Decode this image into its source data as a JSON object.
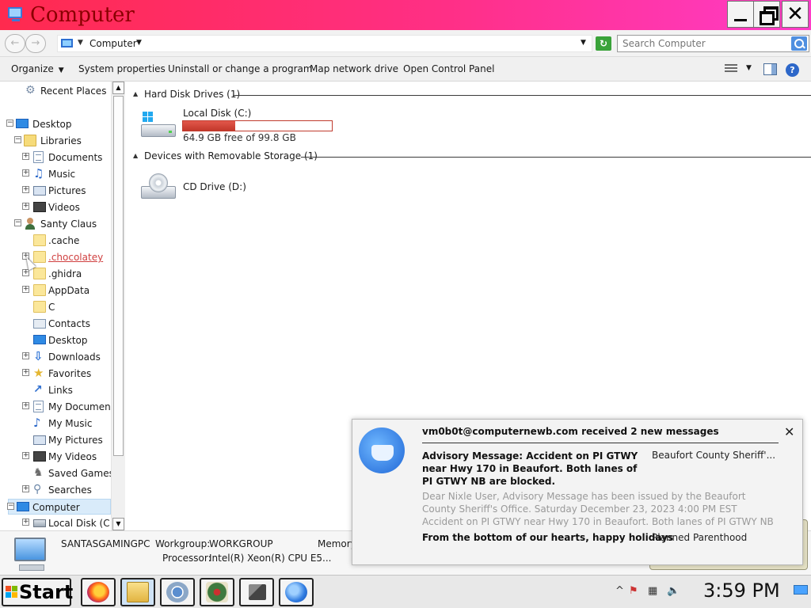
{
  "window": {
    "title": "Computer",
    "minimize_label": "",
    "maximize_label": "",
    "close_label": "✕"
  },
  "address": {
    "crumb": "Computer",
    "search_placeholder": "Search Computer"
  },
  "toolbar": {
    "organize": "Organize",
    "system_properties": "System properties",
    "uninstall": "Uninstall or change a program",
    "map_drive": "Map network drive",
    "control_panel": "Open Control Panel"
  },
  "nav": {
    "recent_places": "Recent Places",
    "desktop": "Desktop",
    "libraries": "Libraries",
    "documents": "Documents",
    "music": "Music",
    "pictures": "Pictures",
    "videos": "Videos",
    "user": "Santy Claus",
    "cache": ".cache",
    "chocolatey": ".chocolatey",
    "ghidra": ".ghidra",
    "appdata": "AppData",
    "c": "C",
    "contacts": "Contacts",
    "desktop2": "Desktop",
    "downloads": "Downloads",
    "favorites": "Favorites",
    "links": "Links",
    "my_documents": "My Documents",
    "my_music": "My Music",
    "my_pictures": "My Pictures",
    "my_videos": "My Videos",
    "saved_games": "Saved Games",
    "searches": "Searches",
    "computer": "Computer",
    "local_disk": "Local Disk (C:)"
  },
  "content": {
    "hdd_group": "Hard Disk Drives (1)",
    "removable_group": "Devices with Removable Storage (1)",
    "local_disk_name": "Local Disk (C:)",
    "local_disk_free": "64.9 GB free of 99.8 GB",
    "local_disk_used_fraction": 0.35,
    "cd_drive_name": "CD Drive (D:)"
  },
  "details": {
    "pc_name": "SANTASGAMINGPC",
    "workgroup_label": "Workgroup:",
    "workgroup_value": "WORKGROUP",
    "memory_label": "Memory",
    "processor_label": "Processor:",
    "processor_value": "Intel(R) Xeon(R) CPU E5..."
  },
  "notification": {
    "header": "vm0b0t@computernewb.com received 2 new messages",
    "close": "✕",
    "subject1": "Advisory Message: Accident on PI GTWY near Hwy 170 in Beaufort. Both lanes of PI GTWY NB are blocked.",
    "sender1": "Beaufort County Sheriff'...",
    "preview1": "Dear Nixle User, Advisory Message has been issued by the Beaufort County Sheriff's Office. Saturday December 23, 2023 4:00 PM EST Accident on PI GTWY near Hwy 170 in Beaufort. Both lanes of PI GTWY NB are blocked. Accident on Parris Island Ga",
    "subject2": "From the bottom of our hearts, happy holidays",
    "sender2": "Planned Parenthood"
  },
  "taskbar": {
    "start": "Start",
    "clock": "3:59 PM",
    "tray_arrow": "^"
  },
  "colors": {
    "titlebar_start": "#ff2a4e",
    "titlebar_end": "#ff3cc8",
    "disk_bar": "#c2382b"
  }
}
